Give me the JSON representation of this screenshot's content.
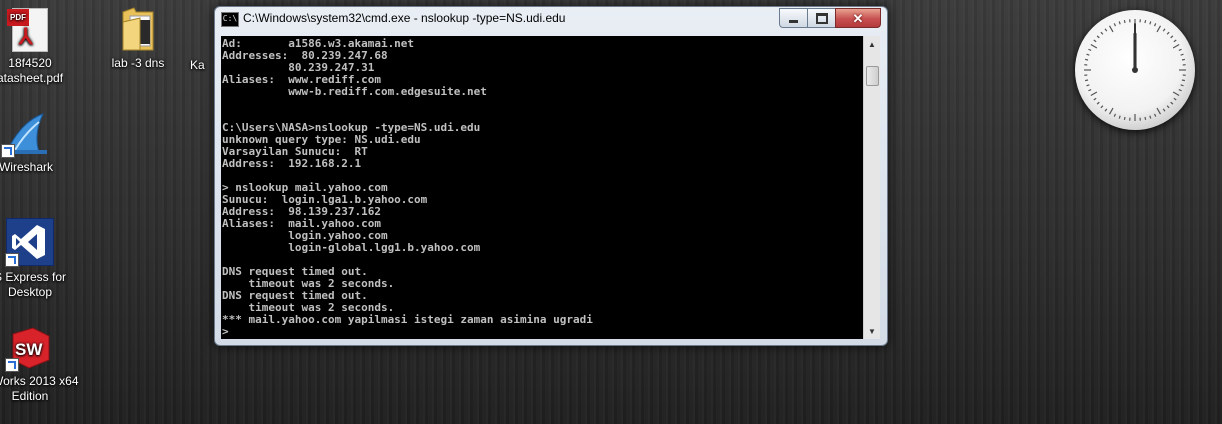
{
  "desktop_icons": [
    {
      "label_line1": "18f4520",
      "label_line2": "atasheet.pdf",
      "icon": "pdf-file-icon"
    },
    {
      "label_line1": "lab -3 dns",
      "icon": "folder-icon"
    },
    {
      "label_line1": "Ka",
      "icon": "file-icon"
    },
    {
      "label_line1": "Wireshark",
      "icon": "wireshark-icon"
    },
    {
      "label_line1": "S Express for",
      "label_line2": "Desktop",
      "icon": "visual-studio-icon"
    },
    {
      "label_line1": "Works 2013 x64",
      "label_line2": "Edition",
      "icon": "solidworks-icon"
    }
  ],
  "cmd_window": {
    "title": "C:\\Windows\\system32\\cmd.exe - nslookup  -type=NS.udi.edu",
    "icon_text": "C:\\",
    "console_lines": [
      "Ad:       a1586.w3.akamai.net",
      "Addresses:  80.239.247.68",
      "          80.239.247.31",
      "Aliases:  www.rediff.com",
      "          www-b.rediff.com.edgesuite.net",
      "",
      "",
      "C:\\Users\\NASA>nslookup -type=NS.udi.edu",
      "unknown query type: NS.udi.edu",
      "Varsayilan Sunucu:  RT",
      "Address:  192.168.2.1",
      "",
      "> nslookup mail.yahoo.com",
      "Sunucu:  login.lga1.b.yahoo.com",
      "Address:  98.139.237.162",
      "Aliases:  mail.yahoo.com",
      "          login.yahoo.com",
      "          login-global.lgg1.b.yahoo.com",
      "",
      "DNS request timed out.",
      "    timeout was 2 seconds.",
      "DNS request timed out.",
      "    timeout was 2 seconds.",
      "*** mail.yahoo.com yapilmasi istegi zaman asimina ugradi",
      ">"
    ]
  },
  "colors": {
    "console_bg": "#000000",
    "console_text": "#c0c0c0",
    "close_button": "#c75050"
  }
}
